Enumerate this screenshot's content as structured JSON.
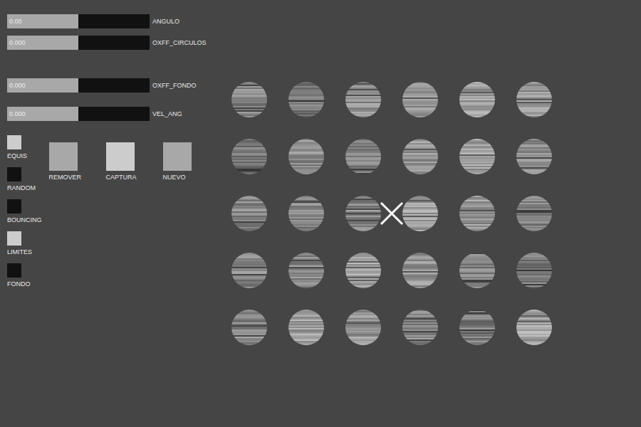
{
  "sliders": [
    {
      "label": "ANGULO",
      "value": "0.00",
      "level": 0.5
    },
    {
      "label": "OXFF_CIRCULOS",
      "value": "0.000",
      "level": 0.5
    },
    {
      "label": "OXFF_FONDO",
      "value": "0.000",
      "level": 0.5
    },
    {
      "label": "VEL_ANG",
      "value": "0.000",
      "level": 0.5
    }
  ],
  "toggles": [
    {
      "label": "EQUIS",
      "on": true
    },
    {
      "label": "RANDOM",
      "on": false
    },
    {
      "label": "BOUNCING",
      "on": false
    },
    {
      "label": "LIMITES",
      "on": true
    },
    {
      "label": "FONDO",
      "on": false
    }
  ],
  "buttons": [
    {
      "label": "REMOVER",
      "hovered": false
    },
    {
      "label": "CAPTURA",
      "hovered": true
    },
    {
      "label": "NUEVO",
      "hovered": false
    }
  ],
  "canvas": {
    "marker_shown": true,
    "circles": [
      {
        "color": "#8a8a8a"
      },
      {
        "color": "#7a7a7a"
      },
      {
        "color": "#959595"
      },
      {
        "color": "#9a9a9a"
      },
      {
        "color": "#a0a0a0"
      },
      {
        "color": "#9c9c9c"
      },
      {
        "color": "#7c7c7c"
      },
      {
        "color": "#8e8e8e"
      },
      {
        "color": "#808080"
      },
      {
        "color": "#9a9a9a"
      },
      {
        "color": "#a2a2a2"
      },
      {
        "color": "#8c8c8c"
      },
      {
        "color": "#888888"
      },
      {
        "color": "#858585"
      },
      {
        "color": "#8e8e8e"
      },
      {
        "color": "#a0a0a0"
      },
      {
        "color": "#989898"
      },
      {
        "color": "#828282"
      },
      {
        "color": "#8a8a8a"
      },
      {
        "color": "#8e8e8e"
      },
      {
        "color": "#a4a4a4"
      },
      {
        "color": "#9a9a9a"
      },
      {
        "color": "#858585"
      },
      {
        "color": "#7e7e7e"
      },
      {
        "color": "#8c8c8c"
      },
      {
        "color": "#a2a2a2"
      },
      {
        "color": "#9a9a9a"
      },
      {
        "color": "#8a8a8a"
      },
      {
        "color": "#7e7e7e"
      },
      {
        "color": "#a6a6a6"
      }
    ]
  }
}
